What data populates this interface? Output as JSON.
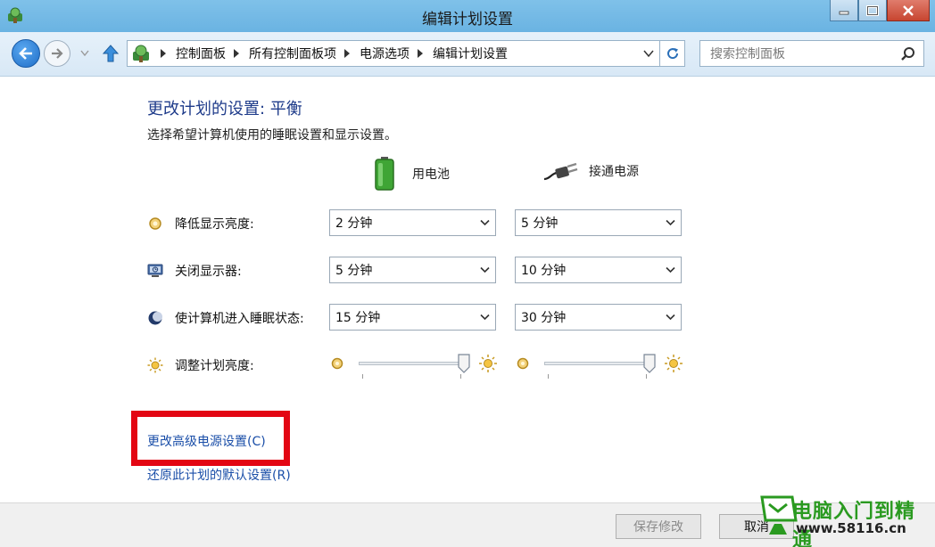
{
  "window": {
    "title": "编辑计划设置"
  },
  "address_bar": {
    "breadcrumbs": [
      "控制面板",
      "所有控制面板项",
      "电源选项",
      "编辑计划设置"
    ],
    "search_placeholder": "搜索控制面板"
  },
  "main": {
    "title": "更改计划的设置: 平衡",
    "subtitle": "选择希望计算机使用的睡眠设置和显示设置。",
    "columns": {
      "battery": "用电池",
      "plugged_in": "接通电源"
    },
    "settings": [
      {
        "label": "降低显示亮度:",
        "battery": "2 分钟",
        "plugged_in": "5 分钟",
        "icon": "dim-display-icon"
      },
      {
        "label": "关闭显示器:",
        "battery": "5 分钟",
        "plugged_in": "10 分钟",
        "icon": "monitor-off-icon"
      },
      {
        "label": "使计算机进入睡眠状态:",
        "battery": "15 分钟",
        "plugged_in": "30 分钟",
        "icon": "sleep-moon-icon"
      }
    ],
    "brightness": {
      "label": "调整计划亮度:",
      "battery_level": 1.0,
      "plugged_in_level": 1.0
    },
    "links": {
      "advanced": "更改高级电源设置(C)",
      "restore": "还原此计划的默认设置(R)"
    }
  },
  "footer": {
    "save": "保存修改",
    "cancel": "取消"
  },
  "watermark": {
    "title": "电脑入门到精通",
    "url": "www.58116.cn"
  },
  "colors": {
    "titlebar": "#6ab3e2",
    "link": "#1a4ea8",
    "heading": "#1e3b8a",
    "highlight": "#e30613",
    "watermark_green": "#2a9a20"
  }
}
